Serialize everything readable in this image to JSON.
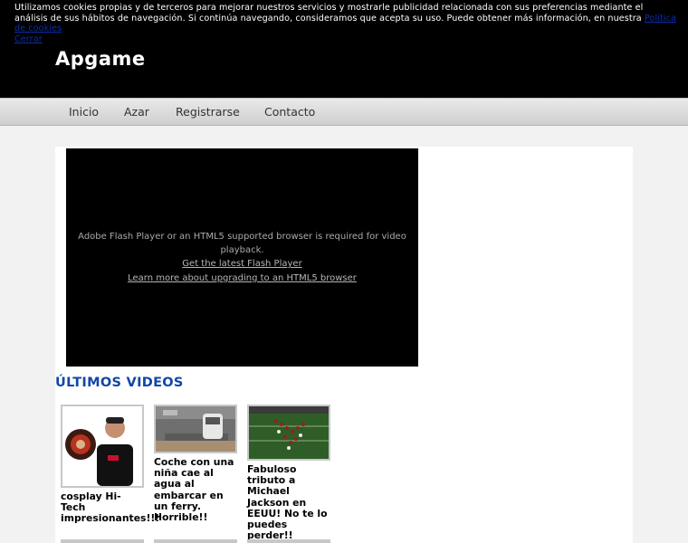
{
  "cookie_notice": {
    "text": "Utilizamos cookies propias y de terceros para mejorar nuestros servicios y mostrarle publicidad relacionada con sus preferencias mediante el análisis de sus hábitos de navegación. Si continúa navegando, consideramos que acepta su uso. Puede obtener más información, en nuestra ",
    "policy_link": "Política de cookies",
    "close_link": "Cerrar"
  },
  "site": {
    "brand": "Apgame"
  },
  "nav": {
    "items": [
      {
        "label": "Inicio"
      },
      {
        "label": "Azar"
      },
      {
        "label": "Registrarse"
      },
      {
        "label": "Contacto"
      }
    ]
  },
  "player": {
    "message": "Adobe Flash Player or an HTML5 supported browser is required for video playback.",
    "flash_link": "Get the latest Flash Player",
    "html5_link": "Learn more about upgrading to an HTML5 browser"
  },
  "latest": {
    "title": "ÚLTIMOS VIDEOS",
    "videos": [
      {
        "title": "cosplay Hi-Tech impresionantes!!!"
      },
      {
        "title": "Coche con una niña cae al agua al embarcar en un ferry. Horrible!!"
      },
      {
        "title": "Fabuloso tributo a Michael Jackson en EEUU! No te lo puedes perder!!"
      }
    ]
  },
  "colors": {
    "header_bg": "#000000",
    "section_title": "#1046a8",
    "link": "#0b2ea8"
  }
}
